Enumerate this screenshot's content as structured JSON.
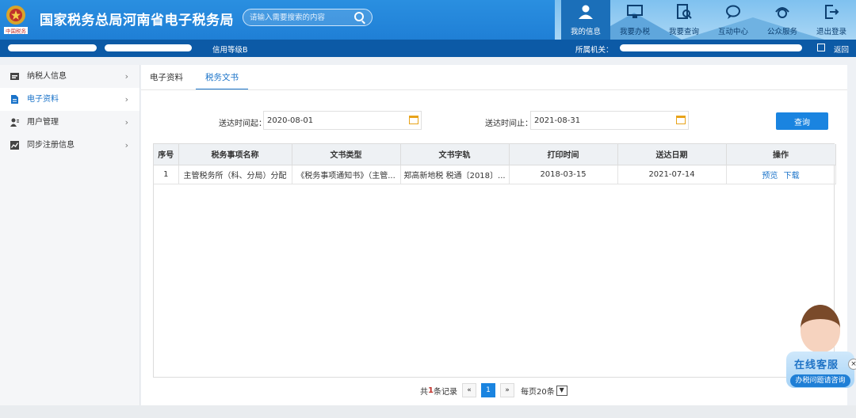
{
  "header": {
    "emblem_text": "中国税务",
    "site_title": "国家税务总局河南省电子税务局",
    "search_placeholder": "请输入需要搜索的内容",
    "nav": [
      {
        "label": "我的信息",
        "icon": "user-icon",
        "active": true
      },
      {
        "label": "我要办税",
        "icon": "monitor-icon",
        "active": false
      },
      {
        "label": "我要查询",
        "icon": "search-doc-icon",
        "active": false
      },
      {
        "label": "互动中心",
        "icon": "chat-icon",
        "active": false
      },
      {
        "label": "公众服务",
        "icon": "service-icon",
        "active": false
      },
      {
        "label": "退出登录",
        "icon": "logout-icon",
        "active": false
      }
    ]
  },
  "infobar": {
    "credit_label": "信用等级B",
    "agency_label": "所属机关：",
    "return_label": "返回"
  },
  "sidebar": {
    "items": [
      {
        "label": "纳税人信息",
        "icon": "id-card-icon",
        "active": false
      },
      {
        "label": "电子资料",
        "icon": "document-icon",
        "active": true
      },
      {
        "label": "用户管理",
        "icon": "user-manage-icon",
        "active": false
      },
      {
        "label": "同步注册信息",
        "icon": "chart-icon",
        "active": false
      }
    ]
  },
  "tabs": [
    {
      "label": "电子资料",
      "active": false
    },
    {
      "label": "税务文书",
      "active": true
    }
  ],
  "filters": {
    "start_label": "送达时间起：",
    "start_value": "2020-08-01",
    "end_label": "送达时间止：",
    "end_value": "2021-08-31",
    "query_label": "查询"
  },
  "table": {
    "headers": [
      "序号",
      "税务事项名称",
      "文书类型",
      "文书字轨",
      "打印时间",
      "送达日期",
      "操作"
    ],
    "rows": [
      {
        "index": "1",
        "name": "主管税务所（科、分局）分配",
        "doc_type": "《税务事项通知书》（主管...",
        "doc_code": "郑高新地税 税通〔2018〕...",
        "print_time": "2018-03-15",
        "delivery_date": "2021-07-14",
        "actions": [
          "预览",
          "下载"
        ]
      }
    ]
  },
  "pager": {
    "total_prefix": "共",
    "total_count": "1",
    "total_suffix": "条记录",
    "prev": "«",
    "current": "1",
    "next": "»",
    "per_page": "每页20条"
  },
  "customer_service": {
    "title": "在线客服",
    "subtitle": "办税问题请咨询",
    "close": "×"
  },
  "colors": {
    "header_blue": "#1f7fd6",
    "infobar_blue": "#0c5aa6",
    "accent": "#1a73c9",
    "calendar": "#e8a31a"
  }
}
